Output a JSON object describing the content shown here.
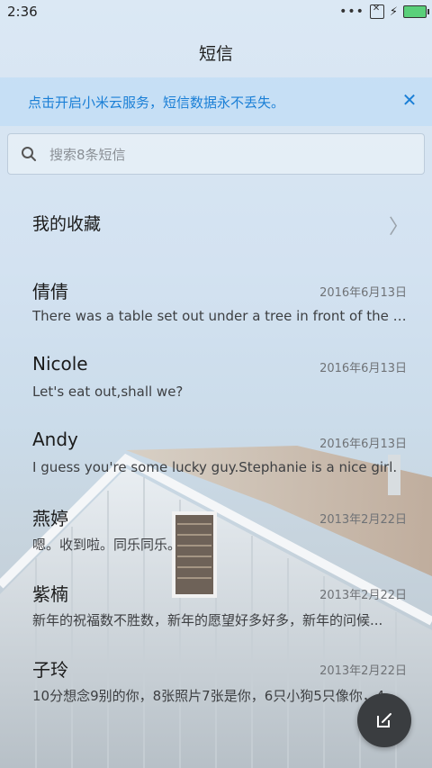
{
  "status_bar": {
    "time": "2:36",
    "dots": "•••"
  },
  "header": {
    "title": "短信"
  },
  "banner": {
    "text": "点击开启小米云服务，短信数据永不丢失。"
  },
  "search": {
    "placeholder": "搜索8条短信"
  },
  "favorites": {
    "label": "我的收藏"
  },
  "messages": [
    {
      "name": "倩倩",
      "date": "2016年6月13日",
      "snippet": "There was a table set out under a tree in front of the house..."
    },
    {
      "name": "Nicole",
      "date": "2016年6月13日",
      "snippet": "Let's eat out,shall we?"
    },
    {
      "name": "Andy",
      "date": "2016年6月13日",
      "snippet": "I guess you're some lucky guy.Stephanie is a nice girl."
    },
    {
      "name": "燕婷",
      "date": "2013年2月22日",
      "snippet": "嗯。收到啦。同乐同乐。"
    },
    {
      "name": "紫楠",
      "date": "2013年2月22日",
      "snippet": "新年的祝福数不胜数，新年的愿望好多好多，新年的问候..."
    },
    {
      "name": "子玲",
      "date": "2013年2月22日",
      "snippet": "10分想念9别的你，8张照片7张是你，6只小狗5只像你，4..."
    }
  ],
  "colors": {
    "accent": "#1a7fd6",
    "fab": "#3a3d40"
  },
  "icons": {
    "search": "search-icon",
    "close": "close-icon",
    "chevron": "chevron-right-icon",
    "compose": "compose-icon"
  }
}
